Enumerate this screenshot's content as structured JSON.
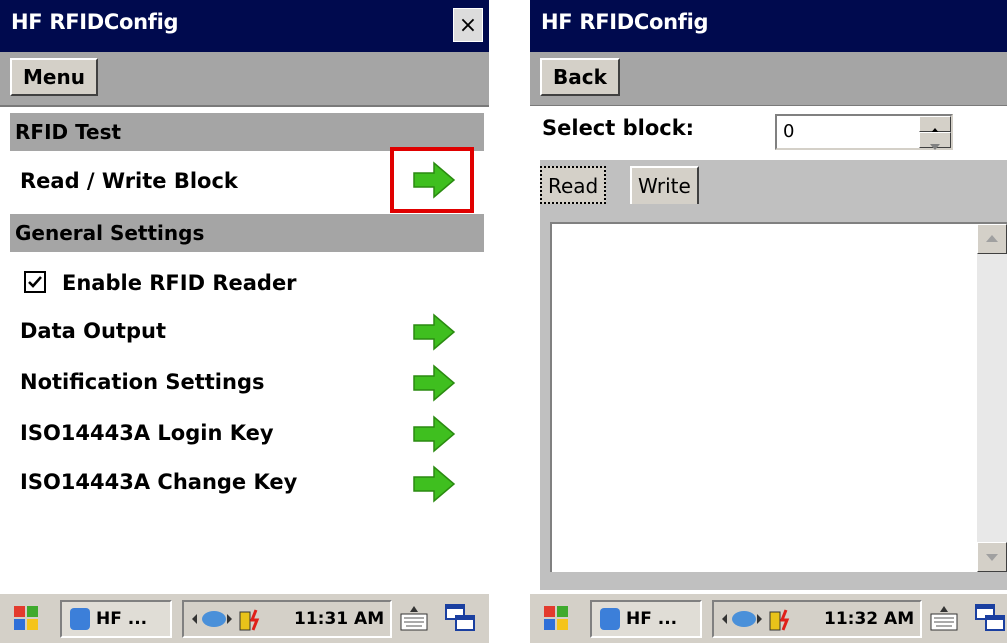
{
  "screen_left": {
    "title": "HF RFIDConfig",
    "close_label": "×",
    "menu_label": "Menu",
    "sections": [
      {
        "label": "RFID Test"
      },
      {
        "label": "General Settings"
      }
    ],
    "items": {
      "read_write": "Read / Write Block",
      "enable_rfid": "Enable RFID Reader",
      "enable_rfid_checked": true,
      "data_output": "Data Output",
      "notification": "Notification Settings",
      "login_key": "ISO14443A Login Key",
      "change_key": "ISO14443A Change Key"
    },
    "taskbar": {
      "app_label": "HF ...",
      "clock": "11:31 AM"
    }
  },
  "screen_right": {
    "title": "HF RFIDConfig",
    "back_label": "Back",
    "select_block_label": "Select block:",
    "select_block_value": "0",
    "tabs": {
      "read": "Read",
      "write": "Write"
    },
    "selected_tab": "Read",
    "taskbar": {
      "app_label": "HF ...",
      "clock": "11:32 AM"
    }
  },
  "colors": {
    "titlebar": "#000a4e",
    "section_bg": "#a5a5a5",
    "arrow_green": "#3fbf1f",
    "highlight_red": "#e00000"
  }
}
